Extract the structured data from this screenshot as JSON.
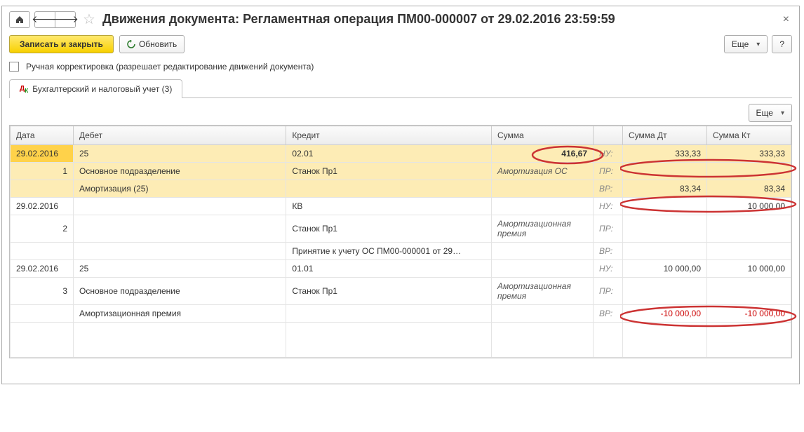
{
  "title": "Движения документа: Регламентная операция ПМ00-000007 от 29.02.2016 23:59:59",
  "toolbar": {
    "save_close": "Записать и закрыть",
    "refresh": "Обновить",
    "more": "Еще",
    "help": "?"
  },
  "manual_edit_label": "Ручная корректировка (разрешает редактирование движений документа)",
  "tab_label": "Бухгалтерский и налоговый учет (3)",
  "sub_more": "Еще",
  "headers": {
    "date": "Дата",
    "debit": "Дебет",
    "credit": "Кредит",
    "sum": "Сумма",
    "sum_dt": "Сумма Дт",
    "sum_kt": "Сумма Кт"
  },
  "types": {
    "nu": "НУ:",
    "pr": "ПР:",
    "vr": "ВР:"
  },
  "rows": [
    {
      "date": "29.02.2016",
      "idx": "1",
      "debit_acc": "25",
      "debit_sub1": "Основное подразделение",
      "debit_sub2": "Амортизация (25)",
      "credit_acc": "02.01",
      "credit_sub1": "Станок Пр1",
      "credit_sub2": "",
      "sum": "416,67",
      "desc": "Амортизация ОС",
      "nu_dt": "333,33",
      "nu_kt": "333,33",
      "pr_dt": "",
      "pr_kt": "",
      "vr_dt": "83,34",
      "vr_kt": "83,34",
      "hl": true
    },
    {
      "date": "29.02.2016",
      "idx": "2",
      "debit_acc": "",
      "debit_sub1": "",
      "debit_sub2": "",
      "credit_acc": "КВ",
      "credit_sub1": "Станок Пр1",
      "credit_sub2": "Принятие к учету ОС ПМ00-000001 от 29…",
      "sum": "",
      "desc": "Амортизационная премия",
      "nu_dt": "",
      "nu_kt": "10 000,00",
      "pr_dt": "",
      "pr_kt": "",
      "vr_dt": "",
      "vr_kt": "",
      "hl": false
    },
    {
      "date": "29.02.2016",
      "idx": "3",
      "debit_acc": "25",
      "debit_sub1": "Основное подразделение",
      "debit_sub2": "Амортизационная премия",
      "credit_acc": "01.01",
      "credit_sub1": "Станок Пр1",
      "credit_sub2": "",
      "sum": "",
      "desc": "Амортизационная премия",
      "nu_dt": "10 000,00",
      "nu_kt": "10 000,00",
      "pr_dt": "",
      "pr_kt": "",
      "vr_dt": "-10 000,00",
      "vr_kt": "-10 000,00",
      "hl": false,
      "neg": true
    }
  ]
}
